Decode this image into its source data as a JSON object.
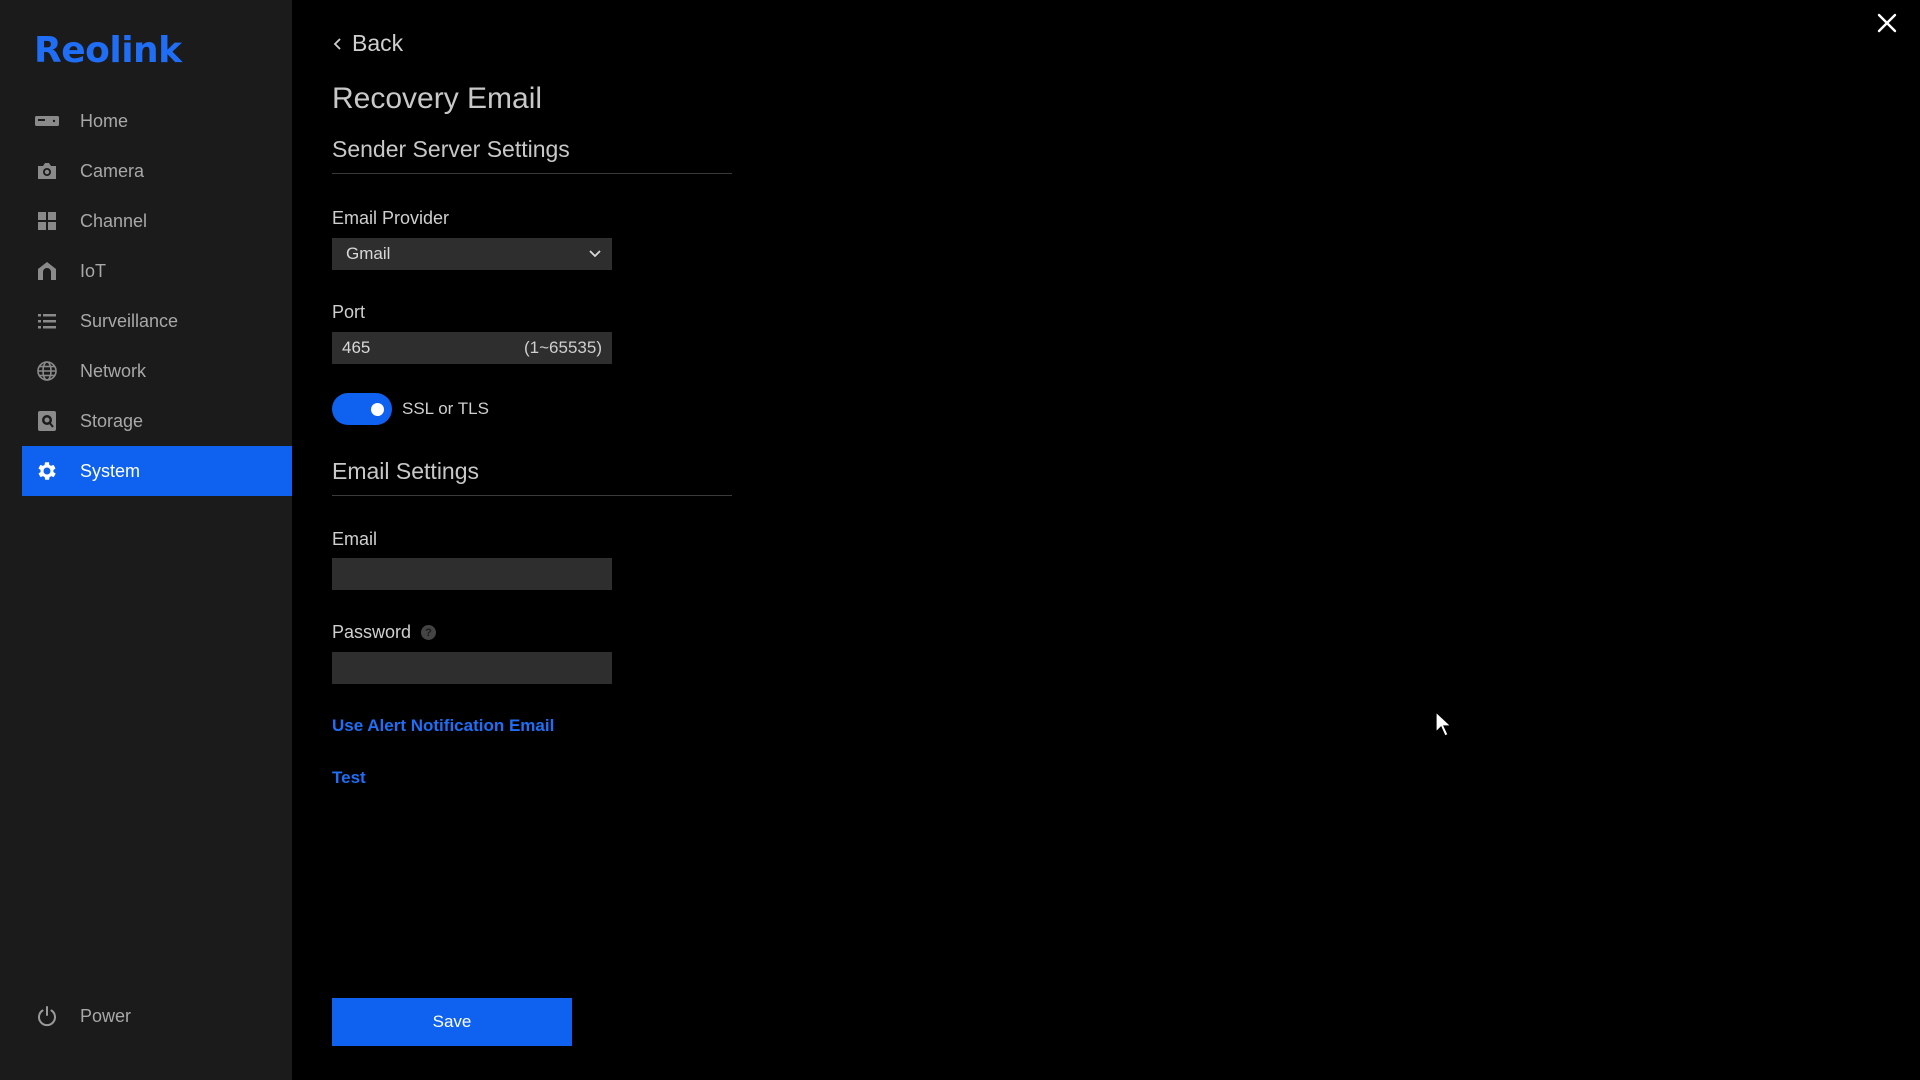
{
  "brand": {
    "logo_text": "Reolink",
    "accent_color": "#0f61f0"
  },
  "sidebar": {
    "items": [
      {
        "label": "Home",
        "icon": "nvr-icon"
      },
      {
        "label": "Camera",
        "icon": "camera-icon"
      },
      {
        "label": "Channel",
        "icon": "grid-icon"
      },
      {
        "label": "IoT",
        "icon": "home-icon"
      },
      {
        "label": "Surveillance",
        "icon": "list-icon"
      },
      {
        "label": "Network",
        "icon": "globe-icon"
      },
      {
        "label": "Storage",
        "icon": "storage-icon"
      },
      {
        "label": "System",
        "icon": "gear-icon",
        "active": true
      }
    ],
    "power_label": "Power"
  },
  "page": {
    "back_label": "Back",
    "title": "Recovery Email",
    "sender_section": "Sender Server Settings",
    "email_provider_label": "Email Provider",
    "email_provider_value": "Gmail",
    "port_label": "Port",
    "port_value": "465",
    "port_range": "(1~65535)",
    "ssl_label": "SSL or TLS",
    "ssl_enabled": true,
    "email_section": "Email Settings",
    "email_label": "Email",
    "email_value": "",
    "password_label": "Password",
    "password_value": "",
    "help_glyph": "?",
    "alert_link": "Use Alert Notification Email",
    "test_link": "Test",
    "save_label": "Save"
  }
}
